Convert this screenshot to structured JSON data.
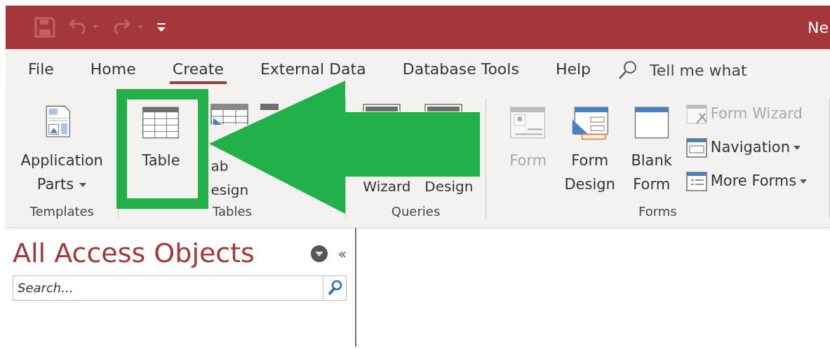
{
  "window": {
    "title": "Ne"
  },
  "tabs": [
    {
      "label": "File",
      "selected": false
    },
    {
      "label": "Home",
      "selected": false
    },
    {
      "label": "Create",
      "selected": true
    },
    {
      "label": "External Data",
      "selected": false
    },
    {
      "label": "Database Tools",
      "selected": false
    },
    {
      "label": "Help",
      "selected": false
    }
  ],
  "tell_me": {
    "placeholder": "Tell me what"
  },
  "ribbon_groups": [
    {
      "label": "Templates",
      "buttons": [
        {
          "kind": "large",
          "lines": [
            "Application",
            "Parts"
          ],
          "dropdown": true,
          "disabled": false
        }
      ]
    },
    {
      "label": "Tables",
      "buttons": [
        {
          "kind": "large",
          "lines": [
            "Table"
          ],
          "dropdown": false,
          "disabled": false
        },
        {
          "kind": "large",
          "lines": [
            "ab",
            "esign"
          ],
          "dropdown": false,
          "disabled": false
        },
        {
          "kind": "large"
        }
      ]
    },
    {
      "label": "Queries",
      "buttons": [
        {
          "kind": "large",
          "lines": [
            "Wizard"
          ],
          "dropdown": false,
          "disabled": false
        },
        {
          "kind": "large",
          "lines": [
            "Design"
          ],
          "dropdown": false,
          "disabled": false
        }
      ]
    },
    {
      "label": "Forms",
      "buttons": [
        {
          "kind": "large",
          "lines": [
            "Form"
          ],
          "dropdown": false,
          "disabled": true
        },
        {
          "kind": "large",
          "lines": [
            "Form",
            "Design"
          ],
          "dropdown": false,
          "disabled": false
        },
        {
          "kind": "large",
          "lines": [
            "Blank",
            "Form"
          ],
          "dropdown": false,
          "disabled": false
        },
        {
          "kind": "small",
          "lines": [
            "Form Wizard"
          ],
          "dropdown": false,
          "disabled": true
        },
        {
          "kind": "small",
          "lines": [
            "Navigation"
          ],
          "dropdown": true,
          "disabled": false
        },
        {
          "kind": "small",
          "lines": [
            "More Forms"
          ],
          "dropdown": true,
          "disabled": false
        }
      ]
    }
  ],
  "nav_pane": {
    "title": "All Access Objects",
    "collapse_glyph": "«",
    "search": {
      "placeholder": "Search..."
    }
  }
}
